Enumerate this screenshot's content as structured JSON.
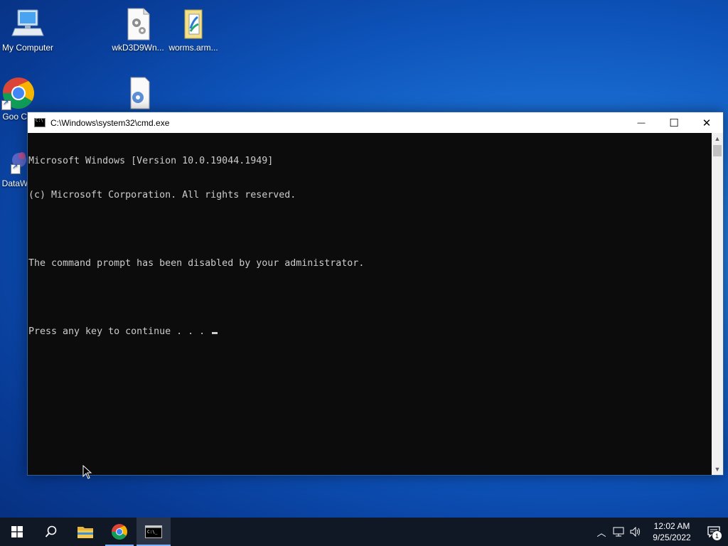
{
  "desktop": {
    "icons": [
      {
        "label": "My Computer",
        "icon": "computer-icon"
      },
      {
        "label": "wkD3D9Wn...",
        "icon": "settings-file-icon"
      },
      {
        "label": "worms.arm...",
        "icon": "document-file-icon"
      },
      {
        "label": "Goo Chr",
        "icon": "chrome-icon"
      },
      {
        "label": "",
        "icon": "settings-file-icon"
      },
      {
        "label": "DataW",
        "icon": "app-shortcut-icon"
      }
    ]
  },
  "window": {
    "title": "C:\\Windows\\system32\\cmd.exe",
    "minimize_glyph": "—",
    "maximize_glyph": "☐",
    "close_glyph": "✕",
    "console_lines": [
      "Microsoft Windows [Version 10.0.19044.1949]",
      "(c) Microsoft Corporation. All rights reserved.",
      "",
      "The command prompt has been disabled by your administrator.",
      "",
      "Press any key to continue . . . "
    ]
  },
  "taskbar": {
    "buttons": [
      {
        "name": "start-button",
        "icon": "windows-logo-icon"
      },
      {
        "name": "search-button",
        "icon": "search-icon"
      },
      {
        "name": "file-explorer-button",
        "icon": "folder-icon"
      },
      {
        "name": "chrome-button",
        "icon": "chrome-icon"
      },
      {
        "name": "cmd-button",
        "icon": "terminal-icon"
      }
    ],
    "tray": {
      "time": "12:02 AM",
      "date": "9/25/2022",
      "notification_count": "1"
    }
  }
}
